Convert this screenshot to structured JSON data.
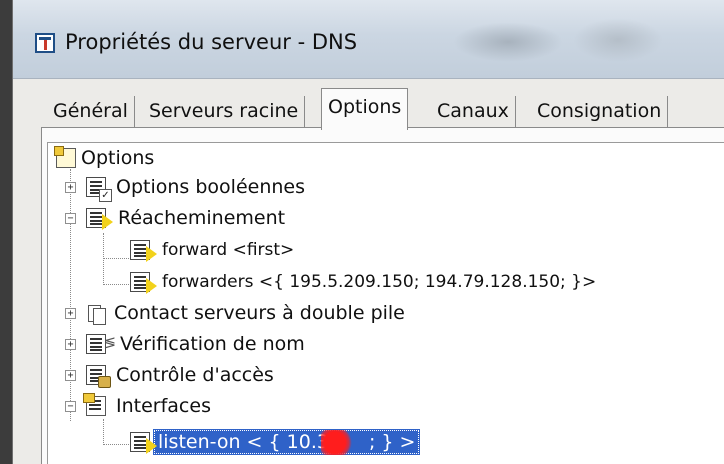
{
  "window": {
    "title": "Propriétés du serveur - DNS"
  },
  "tabs": [
    {
      "label": "Général",
      "active": false
    },
    {
      "label": "Serveurs racine",
      "active": false
    },
    {
      "label": "Options",
      "active": true
    },
    {
      "label": "Canaux",
      "active": false
    },
    {
      "label": "Consignation",
      "active": false
    }
  ],
  "tree": {
    "root": {
      "label": "Options",
      "icon": "options-list-icon"
    },
    "items": [
      {
        "label": "Options booléennes",
        "state": "collapsed",
        "icon": "boolean-options-icon"
      },
      {
        "label": "Réacheminement",
        "state": "expanded",
        "icon": "forwarding-icon"
      },
      {
        "label": "forward  <first>",
        "icon": "forward-icon"
      },
      {
        "label": "forwarders  <{ 195.5.209.150; 194.79.128.150; }>",
        "icon": "forwarders-icon"
      },
      {
        "label": "Contact serveurs à double pile",
        "state": "collapsed",
        "icon": "dual-stack-icon"
      },
      {
        "label": "Vérification de nom",
        "state": "collapsed",
        "icon": "name-check-icon"
      },
      {
        "label": "Contrôle d'accès",
        "state": "collapsed",
        "icon": "access-control-icon"
      },
      {
        "label": "Interfaces",
        "state": "expanded",
        "icon": "interfaces-icon"
      },
      {
        "label": "listen-on < { 10.3.",
        "label_suffix": "; } >",
        "selected": true,
        "icon": "listen-on-icon"
      }
    ]
  },
  "colors": {
    "selection": "#2f62c8",
    "redaction": "#ff1d1d"
  }
}
